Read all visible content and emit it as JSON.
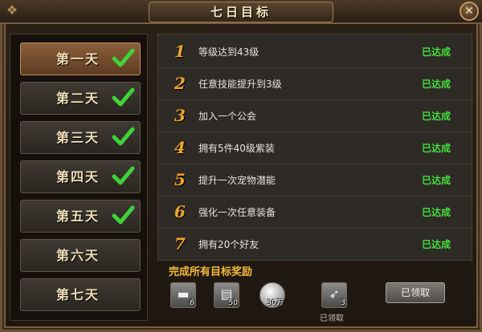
{
  "window": {
    "title": "七日目标",
    "close_glyph": "✕"
  },
  "days": [
    {
      "label": "第一天",
      "completed": true,
      "active": true
    },
    {
      "label": "第二天",
      "completed": true,
      "active": false
    },
    {
      "label": "第三天",
      "completed": true,
      "active": false
    },
    {
      "label": "第四天",
      "completed": true,
      "active": false
    },
    {
      "label": "第五天",
      "completed": true,
      "active": false
    },
    {
      "label": "第六天",
      "completed": false,
      "active": false
    },
    {
      "label": "第七天",
      "completed": false,
      "active": false
    }
  ],
  "tasks": [
    {
      "num": "1",
      "text": "等级达到43级",
      "status": "已达成"
    },
    {
      "num": "2",
      "text": "任意技能提升到3级",
      "status": "已达成"
    },
    {
      "num": "3",
      "text": "加入一个公会",
      "status": "已达成"
    },
    {
      "num": "4",
      "text": "拥有5件40级紫装",
      "status": "已达成"
    },
    {
      "num": "5",
      "text": "提升一次宠物潜能",
      "status": "已达成"
    },
    {
      "num": "6",
      "text": "强化一次任意装备",
      "status": "已达成"
    },
    {
      "num": "7",
      "text": "拥有20个好友",
      "status": "已达成"
    }
  ],
  "reward": {
    "title": "完成所有目标奖励",
    "items": [
      {
        "icon": "anvil-icon",
        "qty": "6"
      },
      {
        "icon": "scroll-icon",
        "qty": "50"
      },
      {
        "icon": "silver-coin-icon",
        "qty": "30万"
      },
      {
        "icon": "feather-icon",
        "qty": "3"
      }
    ],
    "claimed_label": "已领取",
    "claim_button": "已领取"
  },
  "colors": {
    "status_green": "#43e03c",
    "task_number_orange": "#f0a52a",
    "reward_title_gold": "#f4b93b",
    "active_day_brown": "#8a5e3a"
  }
}
